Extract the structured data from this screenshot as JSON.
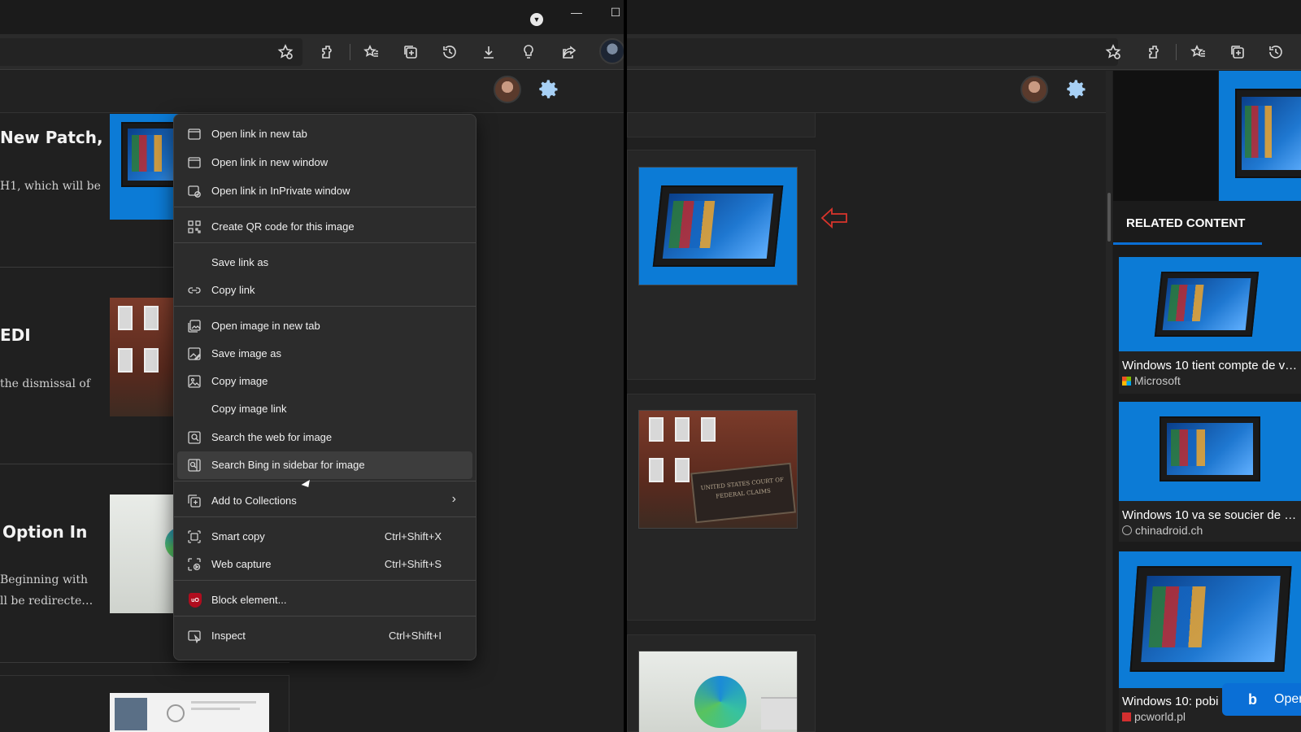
{
  "left_window": {
    "controls": {
      "minimize": "—",
      "maximize": "☐"
    },
    "articles": [
      {
        "title": "New Patch,",
        "excerpt": [
          "H1, which will be"
        ]
      },
      {
        "title": "EDI",
        "excerpt": [
          "the dismissal of"
        ]
      },
      {
        "title": "Option In",
        "excerpt": [
          "Beginning with",
          "ll be redirecte…"
        ]
      }
    ]
  },
  "context_menu": {
    "items": [
      {
        "name": "open-link-new-tab",
        "label": "Open link in new tab",
        "icon": "new-tab-icon"
      },
      {
        "name": "open-link-new-window",
        "label": "Open link in new window",
        "icon": "window-icon"
      },
      {
        "name": "open-link-inprivate",
        "label": "Open link in InPrivate window",
        "icon": "inprivate-icon"
      },
      {
        "name": "create-qr-code",
        "label": "Create QR code for this image",
        "icon": "qr-code-icon"
      },
      {
        "name": "save-link-as",
        "label": "Save link as",
        "icon": ""
      },
      {
        "name": "copy-link",
        "label": "Copy link",
        "icon": "link-icon"
      },
      {
        "name": "open-image-new-tab",
        "label": "Open image in new tab",
        "icon": "image-tab-icon"
      },
      {
        "name": "save-image-as",
        "label": "Save image as",
        "icon": "image-save-icon"
      },
      {
        "name": "copy-image",
        "label": "Copy image",
        "icon": "image-icon"
      },
      {
        "name": "copy-image-link",
        "label": "Copy image link",
        "icon": ""
      },
      {
        "name": "search-web-for-image",
        "label": "Search the web for image",
        "icon": "image-search-icon"
      },
      {
        "name": "search-bing-sidebar",
        "label": "Search Bing in sidebar for image",
        "icon": "sidebar-search-icon"
      },
      {
        "name": "add-to-collections",
        "label": "Add to Collections",
        "icon": "collections-icon"
      },
      {
        "name": "smart-copy",
        "label": "Smart copy",
        "shortcut": "Ctrl+Shift+X",
        "icon": "smart-copy-icon"
      },
      {
        "name": "web-capture",
        "label": "Web capture",
        "shortcut": "Ctrl+Shift+S",
        "icon": "web-capture-icon"
      },
      {
        "name": "block-element",
        "label": "Block element...",
        "icon": "ublock-icon",
        "icon_text": "uO"
      },
      {
        "name": "inspect",
        "label": "Inspect",
        "shortcut": "Ctrl+Shift+I",
        "icon": "inspect-icon"
      }
    ],
    "hovered": "search-bing-sidebar"
  },
  "right_window": {
    "plaque_text": "UNITED STATES COURT OF FEDERAL CLAIMS",
    "sidebar": {
      "heading": "RELATED CONTENT",
      "cards": [
        {
          "title": "Windows 10 tient compte de v…",
          "source": "Microsoft",
          "source_icon": "microsoft-logo-icon"
        },
        {
          "title": "Windows 10 va se soucier de …",
          "source": "chinadroid.ch",
          "source_icon": "globe-icon"
        },
        {
          "title": "Windows 10: pobi",
          "source": "pcworld.pl",
          "source_icon": "pcworld-logo-icon"
        }
      ],
      "bing_button": "Oper"
    }
  },
  "colors": {
    "accent_blue": "#0a6fd6",
    "gear_blue": "#a7d0f5",
    "menu_bg": "#2c2c2c",
    "menu_hover": "#3d3d3d",
    "annotation_red": "#d9342b"
  }
}
